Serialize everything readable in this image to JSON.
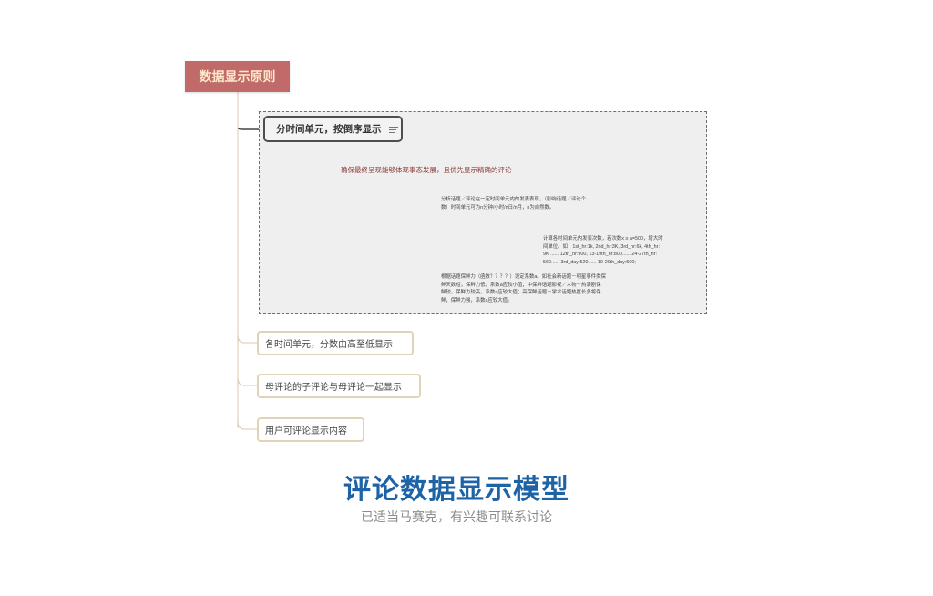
{
  "mindmap": {
    "root": "数据显示原则",
    "group": {
      "topic": "分时间单元，按倒序显示",
      "topic_icon": "notes-icon",
      "subtopic": "确保最终呈现能够体现事态发展，且优先显示精确的评论",
      "notes": [
        "分析话题／评论在一定时间单元内的发表表现，（影响话题／评论个\n数）时间单元可为n分钟/小时/n日/n月，n为自然数。",
        "计算各时间单元内发表次数，若次数x ≥ a=500，增大时\n间单位。如：1st_hr:1k, 2nd_hr:3K, 3rd_hr:6k, 4th_hr:\n9K ...... 12th_hr:900, 13-19th_hr:800...... 24-27th_hr:\n560...... 3rd_day:520...... 10-20th_day:500;",
        "根据话题保鲜力（函数？？？？）设定系数a。如社会新话题－明星事件类保\n鲜天数短，保鲜力低，系数a应较小值；中保鲜话题影视／人物－热演剧保\n鲜较，保鲜力较高，系数a应较大值；高保鲜话题－学术话题热度长多将保\n鲜，保鲜力强，系数a应较大值。"
      ]
    },
    "topics": [
      "各时间单元，分数由高至低显示",
      "母评论的子评论与母评论一起显示",
      "用户可评论显示内容"
    ]
  },
  "footer": {
    "title": "评论数据显示模型",
    "subtitle": "已适当马赛克，有兴趣可联系讨论"
  },
  "colors": {
    "root_bg": "#c06a6a",
    "root_text": "#fbe9c9",
    "secondary_border": "#e1d4b6",
    "title": "#1d63a6",
    "subtitle": "#8c8c8c",
    "subtopic_text": "#8a3b3b"
  }
}
